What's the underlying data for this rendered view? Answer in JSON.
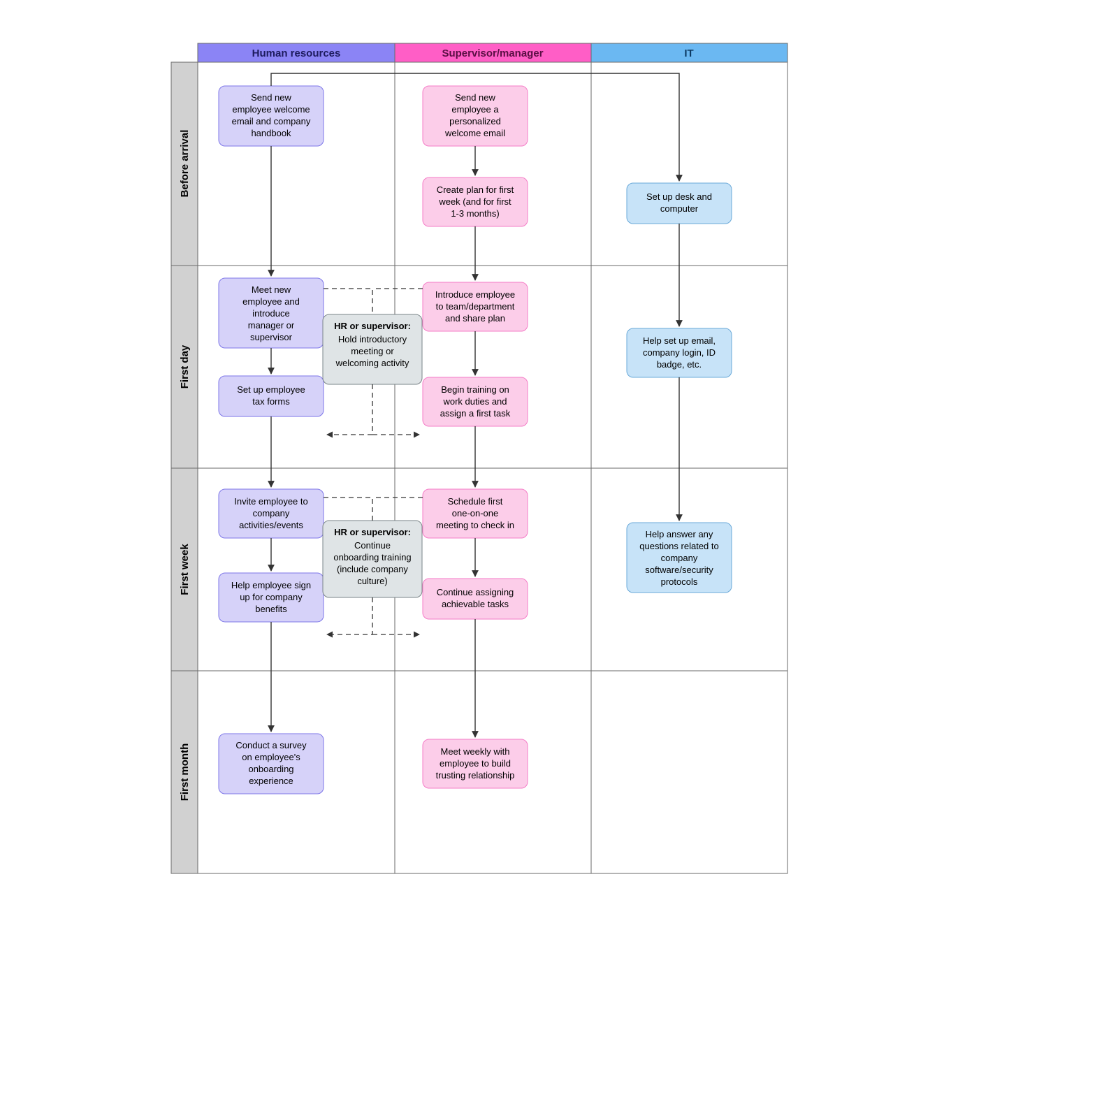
{
  "lanes": {
    "hr": {
      "label": "Human resources",
      "fill": "#8b84f5",
      "text": "#1d1b5e"
    },
    "sup": {
      "label": "Supervisor/manager",
      "fill": "#ff5ec6",
      "text": "#5a0e44"
    },
    "it": {
      "label": "IT",
      "fill": "#6bb8f2",
      "text": "#0d3a63"
    }
  },
  "rows": {
    "before": "Before arrival",
    "day": "First day",
    "week": "First week",
    "month": "First month"
  },
  "boxes": {
    "hr1": [
      "Send new",
      "employee welcome",
      "email and company",
      "handbook"
    ],
    "hr2": [
      "Meet new",
      "employee and",
      "introduce",
      "manager or",
      "supervisor"
    ],
    "hr3": [
      "Set up employee",
      "tax forms"
    ],
    "hr4": [
      "Invite employee to",
      "company",
      "activities/events"
    ],
    "hr5": [
      "Help employee sign",
      "up for company",
      "benefits"
    ],
    "hr6": [
      "Conduct a survey",
      "on employee's",
      "onboarding",
      "experience"
    ],
    "sup1": [
      "Send new",
      "employee a",
      "personalized",
      "welcome email"
    ],
    "sup2": [
      "Create plan for first",
      "week (and for first",
      "1-3 months)"
    ],
    "sup3": [
      "Introduce employee",
      "to team/department",
      "and share plan"
    ],
    "sup4": [
      "Begin training on",
      "work duties and",
      "assign a first task"
    ],
    "sup5": [
      "Schedule first",
      "one-on-one",
      "meeting to check in"
    ],
    "sup6": [
      "Continue assigning",
      "achievable tasks"
    ],
    "sup7": [
      "Meet weekly with",
      "employee to build",
      "trusting relationship"
    ],
    "it1": [
      "Set up desk and",
      "computer"
    ],
    "it2": [
      "Help set up email,",
      "company login, ID",
      "badge, etc."
    ],
    "it3": [
      "Help answer any",
      "questions related to",
      "company",
      "software/security",
      "protocols"
    ],
    "m1_head": "HR or supervisor:",
    "m1": [
      "Hold introductory",
      "meeting or",
      "welcoming activity"
    ],
    "m2_head": "HR or supervisor:",
    "m2": [
      "Continue",
      "onboarding training",
      "(include company",
      "culture)"
    ]
  },
  "colors": {
    "hrBox": {
      "fill": "#d6d2f9",
      "stroke": "#7d76e8"
    },
    "supBox": {
      "fill": "#fccde9",
      "stroke": "#f57cc7"
    },
    "itBox": {
      "fill": "#c7e3f8",
      "stroke": "#6aa9d8"
    },
    "midBox": {
      "fill": "#dfe4e6",
      "stroke": "#7a8488"
    },
    "grey": "#d1d1d1",
    "border": "#6a6a6a"
  }
}
